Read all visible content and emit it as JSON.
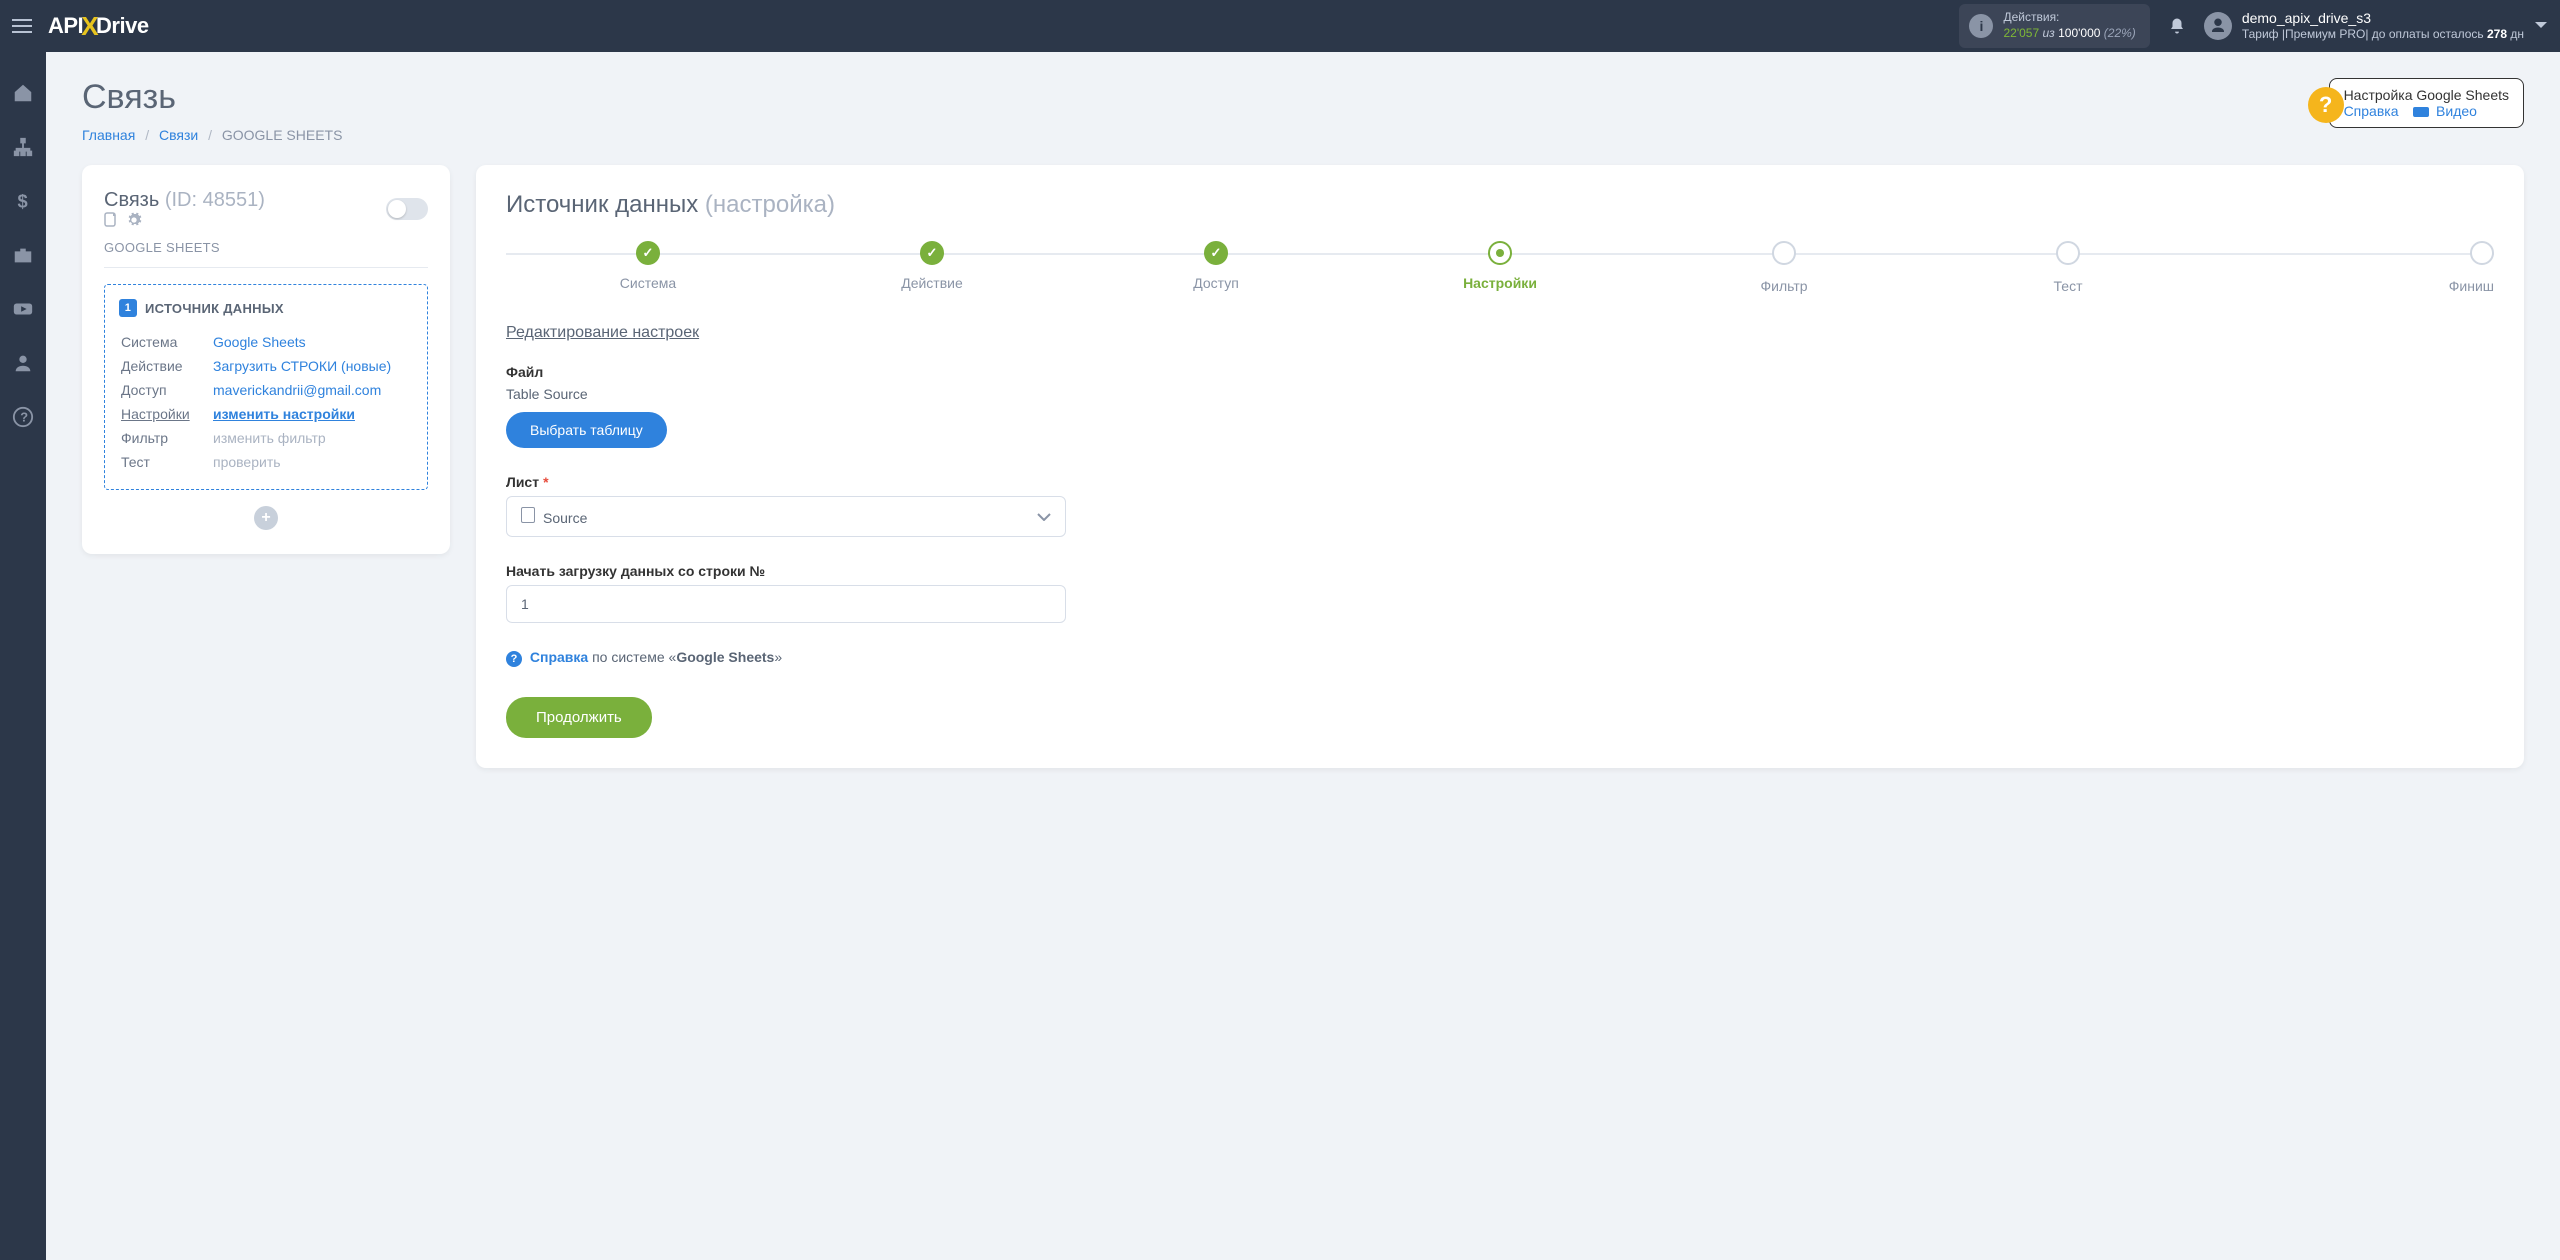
{
  "topbar": {
    "logo_pre": "API",
    "logo_post": "Drive",
    "actions_label": "Действия:",
    "actions_count": "22'057",
    "actions_of": "из",
    "actions_total": "100'000",
    "actions_pct": "(22%)",
    "username": "demo_apix_drive_s3",
    "tariff_pre": "Тариф |Премиум PRO| до оплаты осталось",
    "tariff_days": "278",
    "tariff_suffix": "дн"
  },
  "page": {
    "title": "Связь"
  },
  "breadcrumb": {
    "home": "Главная",
    "links": "Связи",
    "current": "GOOGLE SHEETS"
  },
  "help": {
    "title": "Настройка Google Sheets",
    "ref": "Справка",
    "video": "Видео"
  },
  "left": {
    "title": "Связь",
    "id": "(ID: 48551)",
    "sub": "GOOGLE SHEETS",
    "source_head": "ИСТОЧНИК ДАННЫХ",
    "rows": {
      "system_l": "Система",
      "system_v": "Google Sheets",
      "action_l": "Действие",
      "action_v": "Загрузить СТРОКИ (новые)",
      "access_l": "Доступ",
      "access_v": "maverickandrii@gmail.com",
      "settings_l": "Настройки",
      "settings_v": "изменить настройки",
      "filter_l": "Фильтр",
      "filter_v": "изменить фильтр",
      "test_l": "Тест",
      "test_v": "проверить"
    }
  },
  "right": {
    "title": "Источник данных",
    "title_sub": "(настройка)",
    "steps": {
      "s1": "Система",
      "s2": "Действие",
      "s3": "Доступ",
      "s4": "Настройки",
      "s5": "Фильтр",
      "s6": "Тест",
      "s7": "Финиш"
    },
    "section": "Редактирование настроек",
    "file_label": "Файл",
    "file_value": "Table Source",
    "choose_btn": "Выбрать таблицу",
    "sheet_label": "Лист",
    "sheet_value": "Source",
    "row_label": "Начать загрузку данных со строки №",
    "row_value": "1",
    "help_word": "Справка",
    "help_mid": "по системе «",
    "help_sys": "Google Sheets",
    "help_end": "»",
    "continue": "Продолжить"
  }
}
